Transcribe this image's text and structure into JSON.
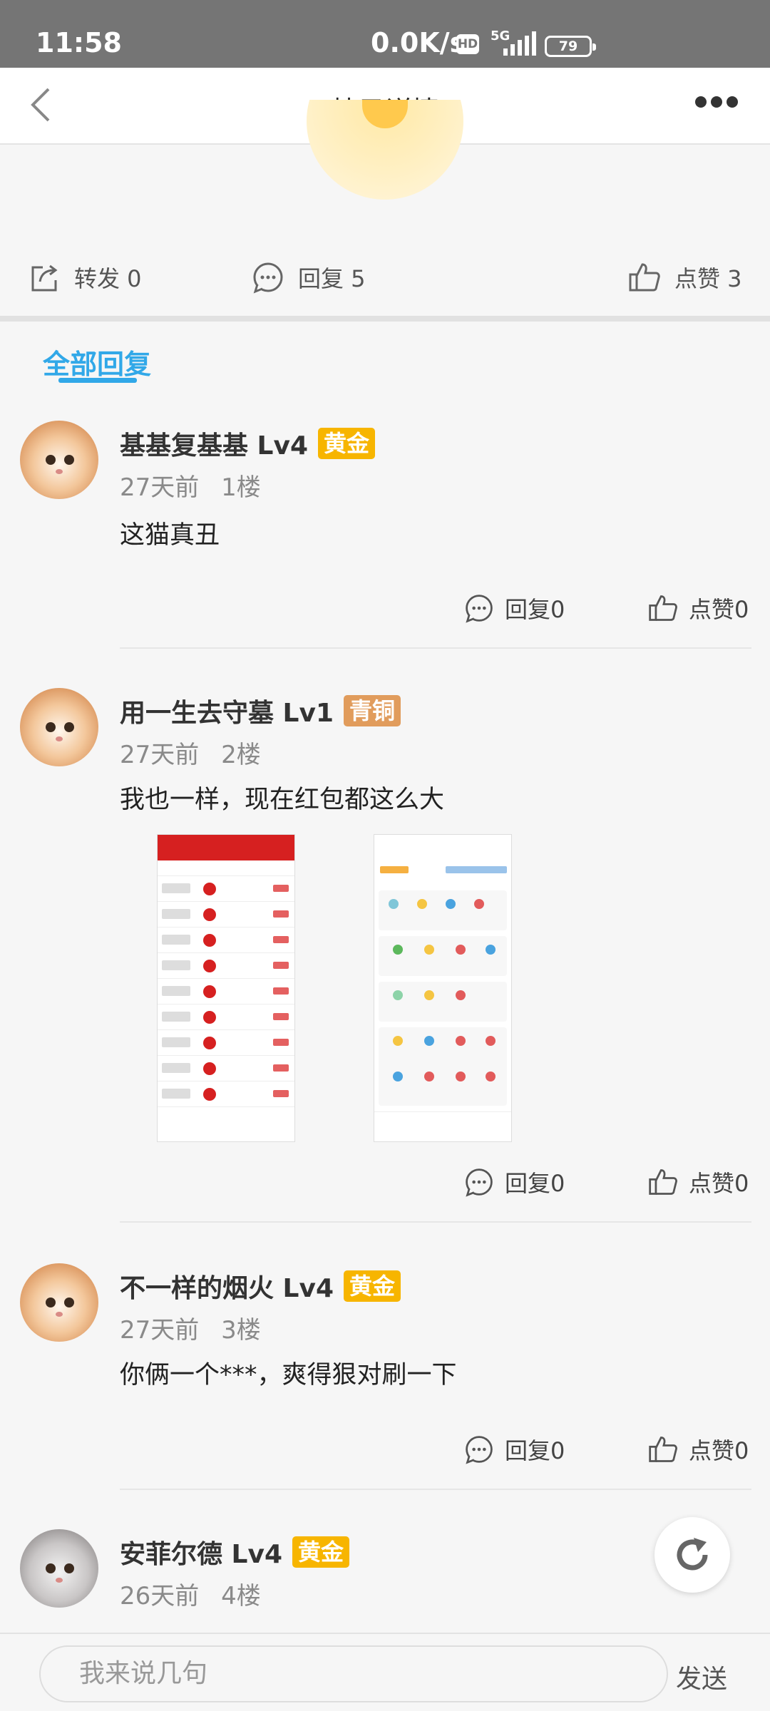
{
  "status_bar": {
    "time": "11:58",
    "network_speed": "0.0K/s",
    "hd": "HD",
    "net_type": "5G",
    "battery": "79"
  },
  "header": {
    "title": "帖子详情"
  },
  "post_actions": {
    "forward": "转发 0",
    "reply": "回复 5",
    "like": "点赞 3"
  },
  "section_title": "全部回复",
  "replies": [
    {
      "name": "基基复基基 Lv4",
      "badge": "黄金",
      "time": "27天前",
      "floor": "1楼",
      "content": "这猫真丑",
      "reply_label": "回复0",
      "like_label": "点赞0"
    },
    {
      "name": "用一生去守墓 Lv1",
      "badge": "青铜",
      "time": "27天前",
      "floor": "2楼",
      "content": "我也一样，现在红包都这么大",
      "reply_label": "回复0",
      "like_label": "点赞0"
    },
    {
      "name": "不一样的烟火 Lv4",
      "badge": "黄金",
      "time": "27天前",
      "floor": "3楼",
      "content": "你俩一个***，爽得狠对刷一下",
      "reply_label": "回复0",
      "like_label": "点赞0"
    },
    {
      "name": "安菲尔德 Lv4",
      "badge": "黄金",
      "time": "26天前",
      "floor": "4楼"
    }
  ],
  "composer": {
    "placeholder": "我来说几句",
    "send_label": "发送"
  },
  "colors": {
    "accent": "#31a8e8",
    "gold_badge": "#f7b500",
    "bronze_badge": "#e19c5c"
  }
}
